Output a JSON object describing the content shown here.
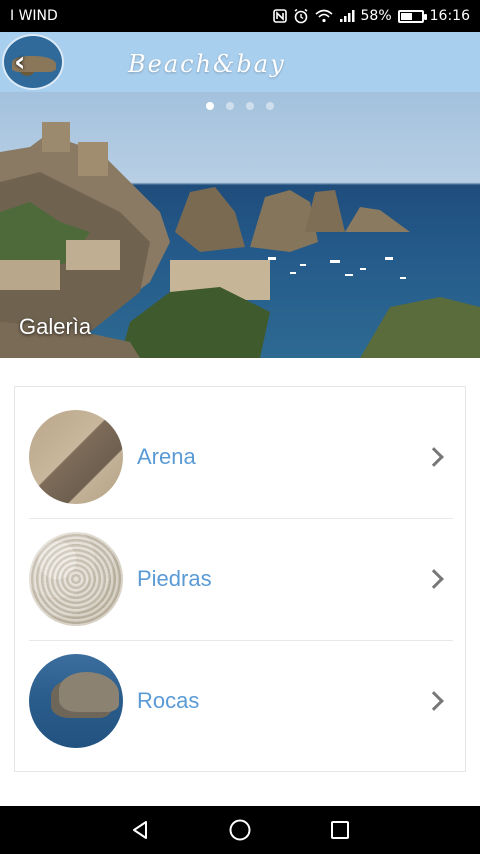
{
  "status": {
    "carrier": "I WIND",
    "battery_percent": "58%",
    "time": "16:16",
    "battery_level": 0.58,
    "icons": [
      "nfc-icon",
      "alarm-icon",
      "wifi-icon",
      "signal-icon",
      "battery-icon"
    ]
  },
  "header": {
    "brand": "Beach&bay",
    "back_icon": "chevron-left-icon",
    "color": "#a9cfee"
  },
  "hero": {
    "title": "Galerìa",
    "dots": 4,
    "active_dot": 0
  },
  "gallery": {
    "items": [
      {
        "label": "Arena",
        "thumb": "sand-photo"
      },
      {
        "label": "Piedras",
        "thumb": "pebbles-photo"
      },
      {
        "label": "Rocas",
        "thumb": "rocks-photo"
      }
    ],
    "label_color": "#5b9bd5"
  },
  "navbar": {
    "icons": [
      "back-triangle-icon",
      "home-circle-icon",
      "recents-square-icon"
    ]
  }
}
